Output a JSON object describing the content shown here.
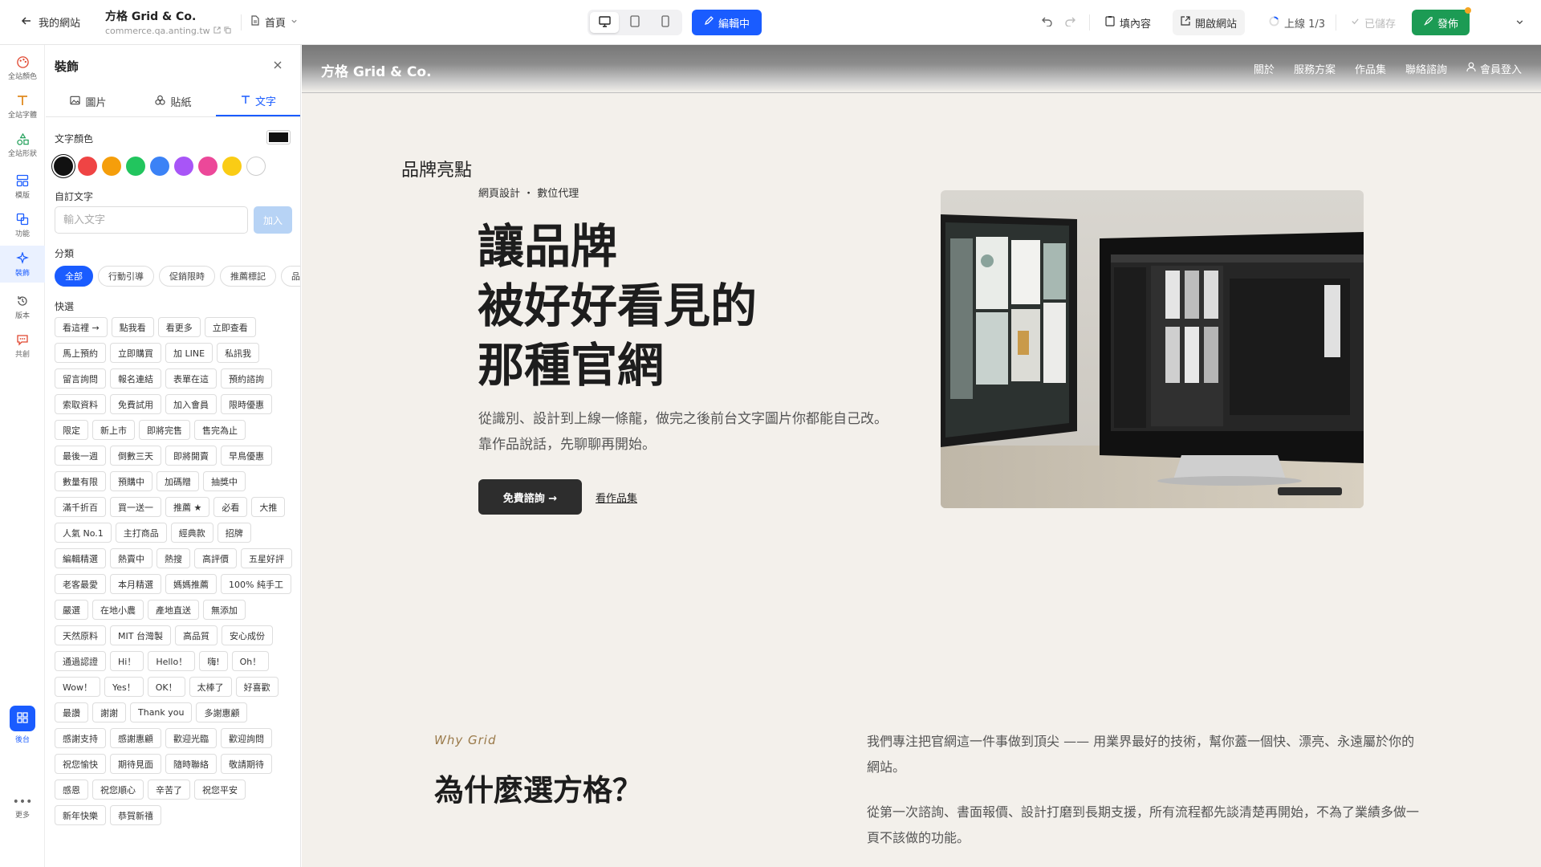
{
  "topbar": {
    "back_label": "我的網站",
    "site_title": "方格 Grid & Co.",
    "site_url": "commerce.qa.anting.tw",
    "page_label": "首頁",
    "edit_label": "編輯中",
    "fill_content_label": "填內容",
    "open_site_label": "開啟網站",
    "progress_label": "上線 1/3",
    "saved_label": "已儲存",
    "publish_label": "發佈"
  },
  "rail": {
    "items": [
      "全站顏色",
      "全站字體",
      "全站形狀",
      "模版",
      "功能",
      "裝飾",
      "版本",
      "共創"
    ],
    "backend_label": "後台",
    "more_label": "更多"
  },
  "panel": {
    "title": "裝飾",
    "tabs": [
      "圖片",
      "貼紙",
      "文字"
    ],
    "text_color_label": "文字顏色",
    "colors": [
      "#111111",
      "#ef4444",
      "#f59e0b",
      "#22c55e",
      "#3b82f6",
      "#a855f7",
      "#ec4899",
      "#facc15",
      "#ffffff"
    ],
    "custom_text_label": "自訂文字",
    "custom_text_placeholder": "輸入文字",
    "add_label": "加入",
    "category_label": "分類",
    "categories": [
      "全部",
      "行動引導",
      "促銷限時",
      "推薦標記",
      "品"
    ],
    "quick_label": "快選",
    "quick_items": [
      "看這裡 →",
      "點我看",
      "看更多",
      "立即查看",
      "馬上預約",
      "立即購買",
      "加 LINE",
      "私訊我",
      "留言詢問",
      "報名連結",
      "表單在這",
      "預約諮詢",
      "索取資料",
      "免費試用",
      "加入會員",
      "限時優惠",
      "限定",
      "新上市",
      "即將完售",
      "售完為止",
      "最後一週",
      "倒數三天",
      "即將開賣",
      "早鳥優惠",
      "數量有限",
      "預購中",
      "加碼贈",
      "抽獎中",
      "滿千折百",
      "買一送一",
      "推薦 ★",
      "必看",
      "大推",
      "人氣 No.1",
      "主打商品",
      "經典款",
      "招牌",
      "編輯精選",
      "熱賣中",
      "熱搜",
      "高評價",
      "五星好評",
      "老客最愛",
      "本月精選",
      "媽媽推薦",
      "100% 純手工",
      "嚴選",
      "在地小農",
      "產地直送",
      "無添加",
      "天然原料",
      "MIT 台灣製",
      "高品質",
      "安心成份",
      "通過認證",
      "Hi！",
      "Hello！",
      "嗨!",
      "Oh！",
      "Wow！",
      "Yes！",
      "OK！",
      "太棒了",
      "好喜歡",
      "最讚",
      "謝謝",
      "Thank you",
      "多謝惠顧",
      "感謝支持",
      "感謝惠顧",
      "歡迎光臨",
      "歡迎詢問",
      "祝您愉快",
      "期待見面",
      "隨時聯絡",
      "敬請期待",
      "感恩",
      "祝您順心",
      "辛苦了",
      "祝您平安",
      "新年快樂",
      "恭賀新禧"
    ]
  },
  "site": {
    "logo": "方格 Grid & Co.",
    "nav": [
      "關於",
      "服務方案",
      "作品集",
      "聯絡諮詢"
    ],
    "login_label": "會員登入",
    "section_heading": "品牌亮點",
    "eyebrow": "網頁設計 ・ 數位代理",
    "hero_lines": [
      "讓品牌",
      "被好好看見的",
      "那種官網"
    ],
    "hero_desc": "從識別、設計到上線一條龍，做完之後前台文字圖片你都能自己改。靠作品說話，先聊聊再開始。",
    "cta_label": "免費諮詢 →",
    "link_label": "看作品集",
    "why_tag": "Why Grid",
    "why_title": "為什麼選方格？",
    "why_p1": "我們專注把官網這一件事做到頂尖 —— 用業界最好的技術，幫你蓋一個快、漂亮、永遠屬於你的網站。",
    "why_p2": "從第一次諮詢、書面報價、設計打磨到長期支援，所有流程都先談清楚再開始，不為了業績多做一頁不該做的功能。"
  }
}
